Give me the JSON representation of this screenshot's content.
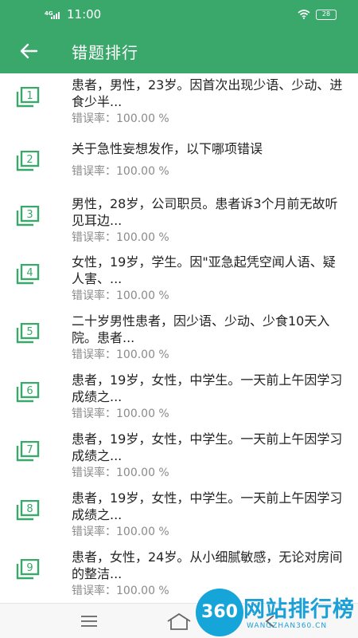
{
  "status": {
    "network": "4G",
    "time": "11:00",
    "battery": "28"
  },
  "header": {
    "title": "错题排行"
  },
  "items": [
    {
      "num": "1",
      "question": "患者，男性，23岁。因首次出现少语、少动、进食少半...",
      "rate": "错误率：100.00 %"
    },
    {
      "num": "2",
      "question": "关于急性妄想发作，以下哪项错误",
      "rate": "错误率：100.00 %"
    },
    {
      "num": "3",
      "question": "男性，28岁，公司职员。患者诉3个月前无故听见耳边...",
      "rate": "错误率：100.00 %"
    },
    {
      "num": "4",
      "question": "女性，19岁，学生。因\"亚急起凭空闻人语、疑人害、...",
      "rate": "错误率：100.00 %"
    },
    {
      "num": "5",
      "question": "二十岁男性患者，因少语、少动、少食10天入院。患者...",
      "rate": "错误率：100.00 %"
    },
    {
      "num": "6",
      "question": "患者，19岁，女性，中学生。一天前上午因学习成绩之...",
      "rate": "错误率：100.00 %"
    },
    {
      "num": "7",
      "question": "患者，19岁，女性，中学生。一天前上午因学习成绩之...",
      "rate": "错误率：100.00 %"
    },
    {
      "num": "8",
      "question": "患者，19岁，女性，中学生。一天前上午因学习成绩之...",
      "rate": "错误率：100.00 %"
    },
    {
      "num": "9",
      "question": "患者，女性，24岁。从小细腻敏感，无论对房间的整洁...",
      "rate": "错误率：100.00 %"
    }
  ],
  "watermark": {
    "logo": "360",
    "text": "网站排行榜",
    "url": "WANGZHAN360.CN"
  },
  "icons": {
    "back": "arrow-left-icon",
    "badge": "numbered-stack-icon",
    "menu": "menu-icon",
    "home": "home-icon",
    "system_back": "system-back-icon"
  },
  "colors": {
    "primary": "#3aa86b",
    "badge": "#3aa86b",
    "text": "#222222",
    "subtext": "#8a8a8a",
    "watermark": "#1aa0d6"
  }
}
